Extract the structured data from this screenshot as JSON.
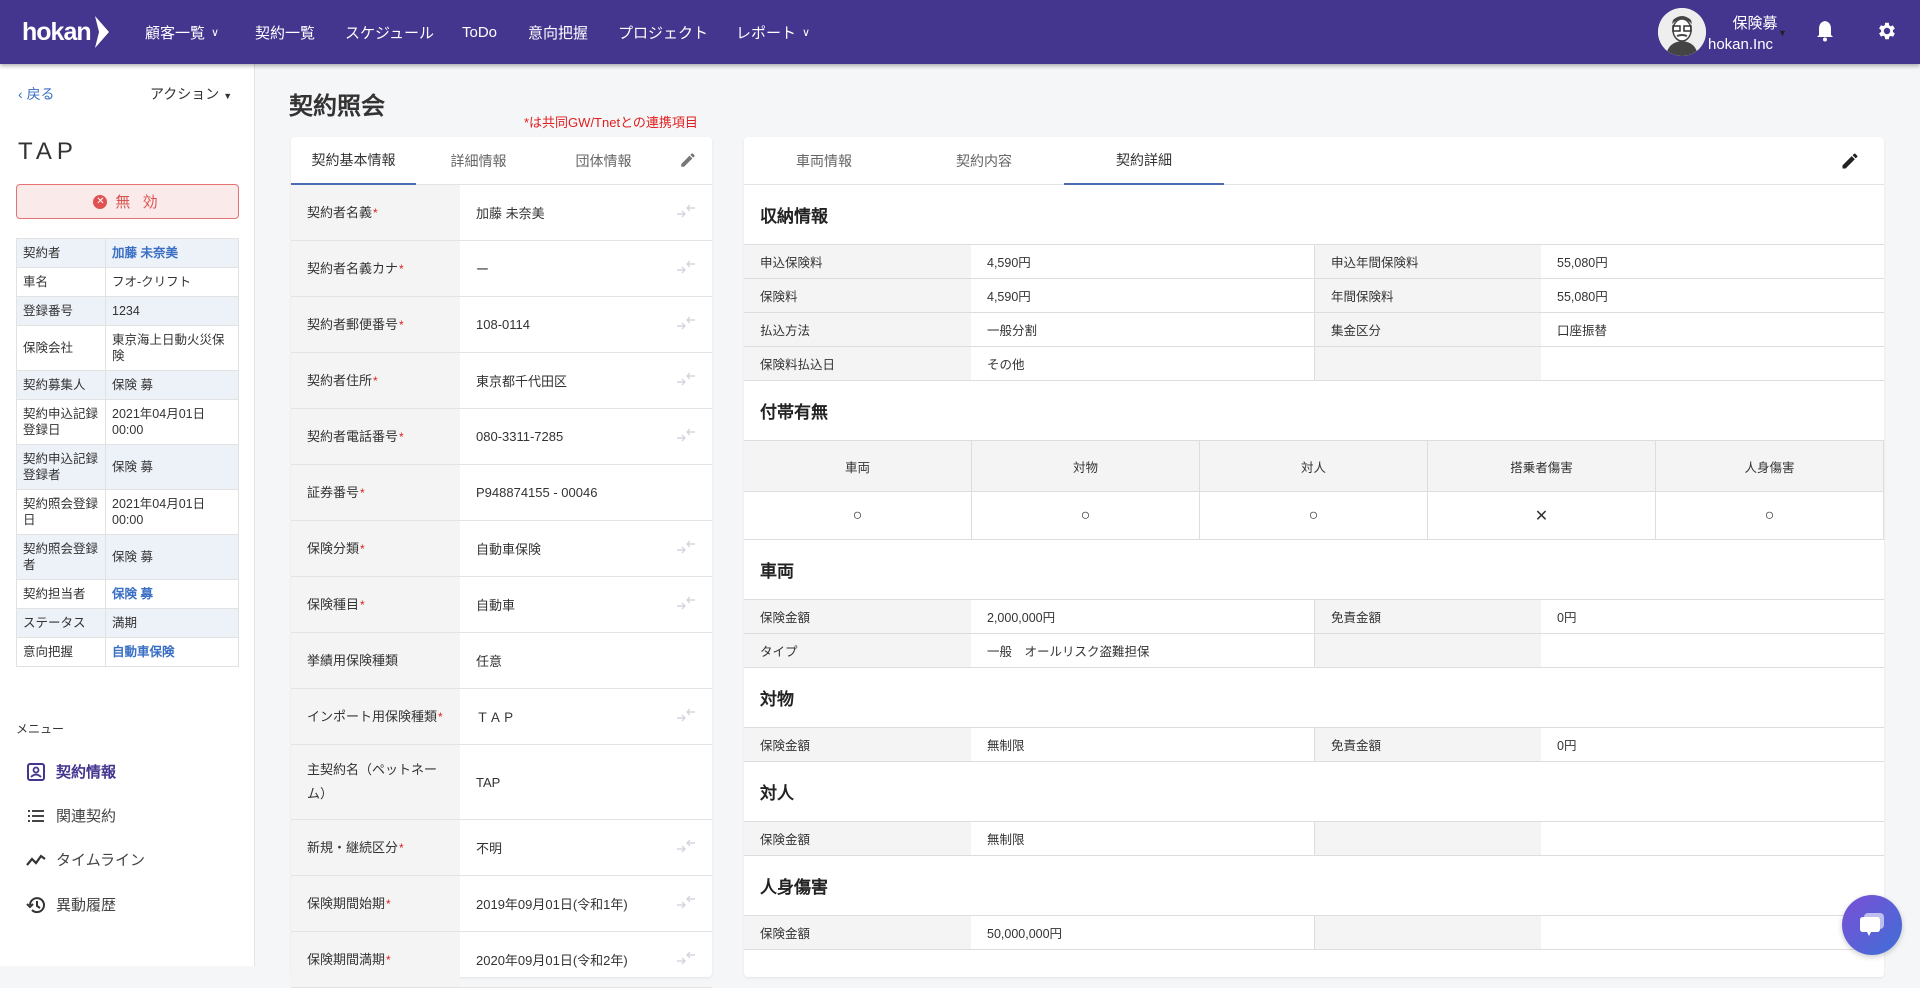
{
  "header": {
    "logo": "hokan",
    "nav": [
      {
        "label": "顧客一覧",
        "dropdown": true
      },
      {
        "label": "契約一覧",
        "dropdown": false
      },
      {
        "label": "スケジュール",
        "dropdown": false
      },
      {
        "label": "ToDo",
        "dropdown": false
      },
      {
        "label": "意向把握",
        "dropdown": false
      },
      {
        "label": "プロジェクト",
        "dropdown": false
      },
      {
        "label": "レポート",
        "dropdown": true
      }
    ],
    "user_name": "保険募",
    "user_org": "hokan.Inc",
    "bg_color": "#44358f"
  },
  "sidebar": {
    "back": "戻る",
    "action": "アクション",
    "name": "TAP",
    "status": "無 効",
    "info": [
      {
        "label": "契約者",
        "value": "加藤 未奈美",
        "link": true
      },
      {
        "label": "車名",
        "value": "フオ-クリフト"
      },
      {
        "label": "登録番号",
        "value": "1234"
      },
      {
        "label": "保険会社",
        "value": "東京海上日動火災保険"
      },
      {
        "label": "契約募集人",
        "value": "保険 募"
      },
      {
        "label": "契約申込記録登録日",
        "value": "2021年04月01日 00:00"
      },
      {
        "label": "契約申込記録登録者",
        "value": "保険 募"
      },
      {
        "label": "契約照会登録日",
        "value": "2021年04月01日 00:00"
      },
      {
        "label": "契約照会登録者",
        "value": "保険 募"
      },
      {
        "label": "契約担当者",
        "value": "保険 募",
        "link": true
      },
      {
        "label": "ステータス",
        "value": "満期"
      },
      {
        "label": "意向把握",
        "value": "自動車保険",
        "link": true
      }
    ],
    "menu_heading": "メニュー",
    "menu": [
      {
        "label": "契約情報",
        "icon": "contact-card-icon",
        "active": true
      },
      {
        "label": "関連契約",
        "icon": "list-icon"
      },
      {
        "label": "タイムライン",
        "icon": "timeline-icon"
      },
      {
        "label": "異動履歴",
        "icon": "history-icon"
      }
    ]
  },
  "page": {
    "title": "契約照会",
    "note": "*は共同GW/Tnetとの連携項目"
  },
  "left_card": {
    "tabs": [
      "契約基本情報",
      "詳細情報",
      "団体情報"
    ],
    "active_tab": 0,
    "rows": [
      {
        "label": "契約者名義",
        "req": "*",
        "value": "加藤 未奈美",
        "sync": true
      },
      {
        "label": "契約者名義カナ",
        "req": "*",
        "value": "ー",
        "sync": true
      },
      {
        "label": "契約者郵便番号",
        "req": "*",
        "value": "108-0114",
        "sync": true
      },
      {
        "label": "契約者住所",
        "req": "*",
        "value": "東京都千代田区",
        "sync": true
      },
      {
        "label": "契約者電話番号",
        "req": "*",
        "value": "080-3311-7285",
        "sync": true
      },
      {
        "label": "証券番号",
        "req": "*",
        "value": "P948874155 - 00046",
        "sync": false
      },
      {
        "label": "保険分類",
        "req": "*",
        "value": "自動車保険",
        "sync": true
      },
      {
        "label": "保険種目",
        "req": "*",
        "value": "自動車",
        "sync": true
      },
      {
        "label": "挙績用保険種類",
        "req": "",
        "value": "任意",
        "sync": false
      },
      {
        "label": "インポート用保険種類",
        "req": "*",
        "value": "ＴＡＰ",
        "sync": true
      },
      {
        "label": "主契約名（ペットネーム）",
        "req": "",
        "value": "TAP",
        "sync": false,
        "tall": true
      },
      {
        "label": "新規・継続区分",
        "req": "*",
        "value": "不明",
        "sync": true
      },
      {
        "label": "保険期間始期",
        "req": "*",
        "value": "2019年09月01日(令和1年)",
        "sync": true
      },
      {
        "label": "保険期間満期",
        "req": "*",
        "value": "2020年09月01日(令和2年)",
        "sync": true
      }
    ]
  },
  "right_card": {
    "tabs": [
      "車両情報",
      "契約内容",
      "契約詳細"
    ],
    "active_tab": 2,
    "payment": {
      "title": "収納情報",
      "rows": [
        [
          "申込保険料",
          "4,590円",
          "申込年間保険料",
          "55,080円"
        ],
        [
          "保険料",
          "4,590円",
          "年間保険料",
          "55,080円"
        ],
        [
          "払込方法",
          "一般分割",
          "集金区分",
          "口座振替"
        ],
        [
          "保険料払込日",
          "その他",
          "",
          ""
        ]
      ]
    },
    "coverage": {
      "title": "付帯有無",
      "headers": [
        "車両",
        "対物",
        "対人",
        "搭乗者傷害",
        "人身傷害"
      ],
      "values": [
        "○",
        "○",
        "○",
        "✕",
        "○"
      ]
    },
    "sections": [
      {
        "title": "車両",
        "rows": [
          [
            "保険金額",
            "2,000,000円",
            "免責金額",
            "0円"
          ],
          [
            "タイプ",
            "一般　オールリスク盗難担保",
            "",
            ""
          ]
        ]
      },
      {
        "title": "対物",
        "rows": [
          [
            "保険金額",
            "無制限",
            "免責金額",
            "0円"
          ]
        ]
      },
      {
        "title": "対人",
        "rows": [
          [
            "保険金額",
            "無制限",
            "",
            ""
          ]
        ]
      },
      {
        "title": "人身傷害",
        "rows": [
          [
            "保険金額",
            "50,000,000円",
            "",
            ""
          ]
        ]
      }
    ]
  }
}
